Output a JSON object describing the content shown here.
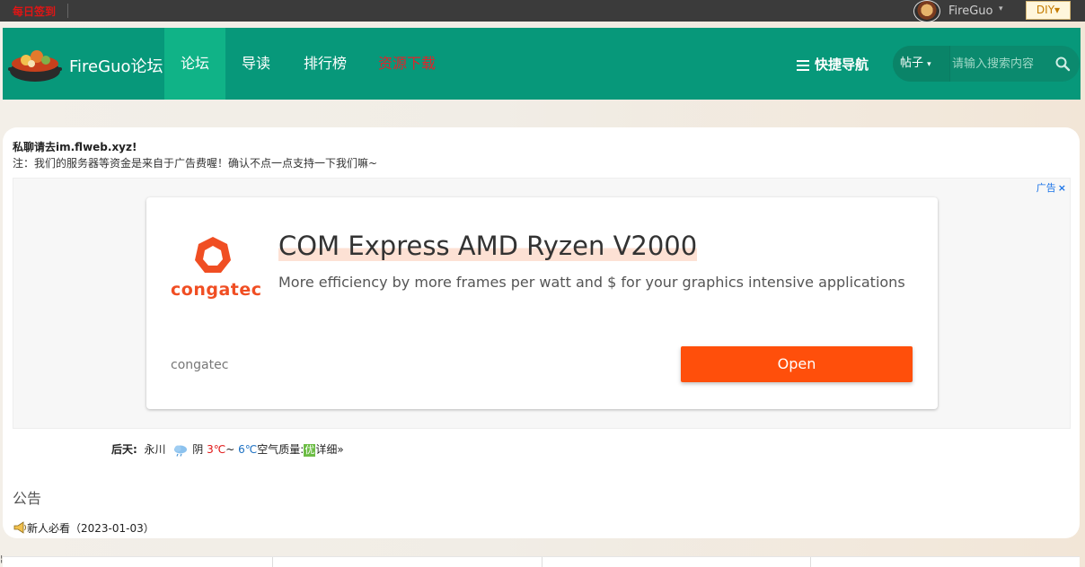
{
  "topbar": {
    "daily_link": "每日签到",
    "username": "FireGuo",
    "diy_label": "DIY"
  },
  "nav": {
    "logo_text": "FireGuo论坛",
    "items": [
      {
        "label": "论坛",
        "active": true
      },
      {
        "label": "导读",
        "active": false
      },
      {
        "label": "排行榜",
        "active": false
      },
      {
        "label": "资源下载",
        "active": false,
        "color": "#e0242a"
      }
    ],
    "quick_nav_label": "快捷导航",
    "search_type": "帖子",
    "search_placeholder": "请输入搜索内容"
  },
  "notice": {
    "line1": "私聊请去im.flweb.xyz!",
    "line2": "注：我们的服务器等资金是来自于广告费喔！确认不点一点支持一下我们嘛~"
  },
  "ad": {
    "label": "广告",
    "close_icon": "×",
    "logo_text": "congatec",
    "title": "COM Express AMD Ryzen V2000",
    "description": "More efficiency by more frames per watt and $ for your graphics intensive applications",
    "brand": "congatec",
    "button": "Open",
    "accent_color": "#ff4f0b"
  },
  "weather": {
    "day": "后天:",
    "city": "永川",
    "condition": "阴",
    "high": "3℃",
    "tilde": "~",
    "low": "6℃",
    "air_label": "空气质量:",
    "air_value": "优",
    "detail": "详细»"
  },
  "announcement": {
    "title": "公告",
    "item": "新人必看（2023-01-03）"
  }
}
